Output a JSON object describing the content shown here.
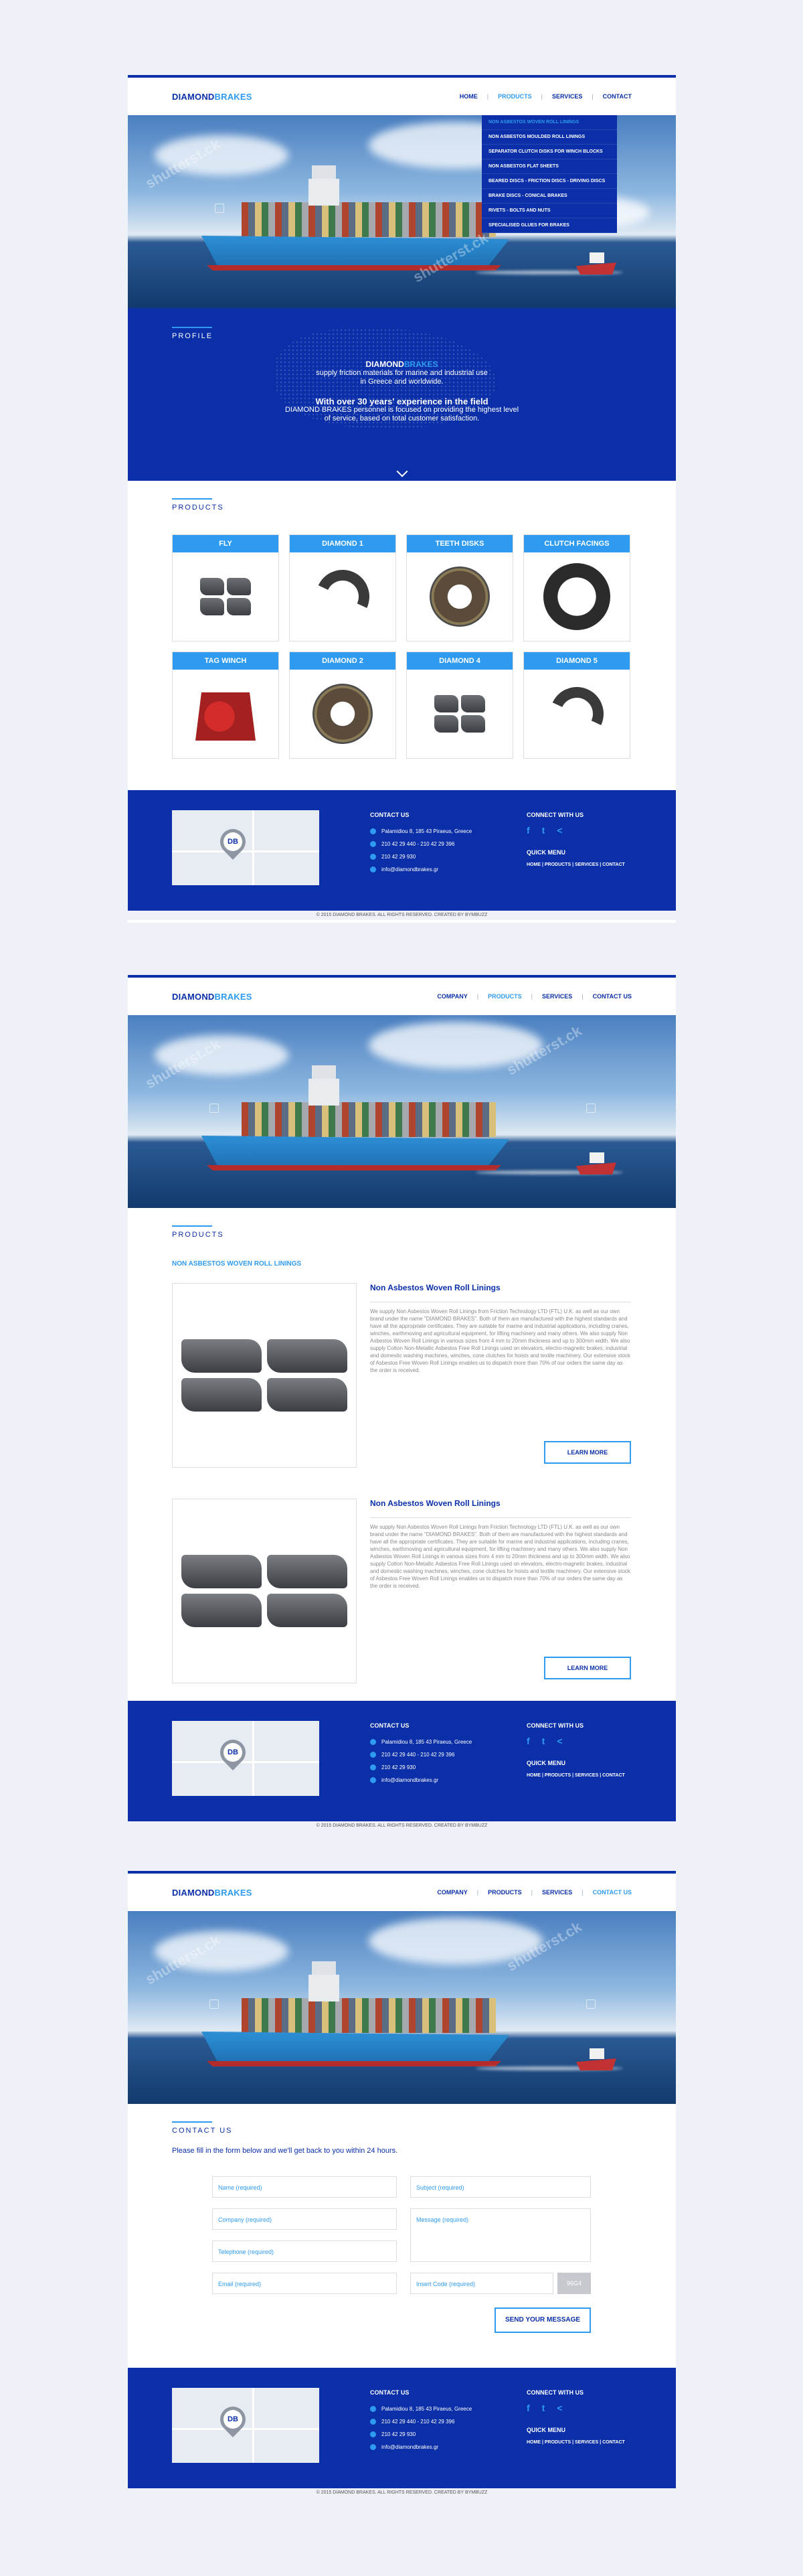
{
  "brand": {
    "part1": "DIAMOND",
    "part2": "BRAKES"
  },
  "nav1": {
    "items": [
      "HOME",
      "PRODUCTS",
      "SERVICES",
      "CONTACT"
    ]
  },
  "nav": {
    "items": [
      "COMPANY",
      "PRODUCTS",
      "SERVICES",
      "CONTACT US"
    ]
  },
  "dropdown": {
    "items": [
      "NON ASBESTOS WOVEN ROLL LININGS",
      "NON ASBESTOS MOULDED ROLL LININGS",
      "SEPARATOR CLUTCH DISKS FOR WINCH BLOCKS",
      "NON ASBESTOS FLAT SHEETS",
      "BEARED DISCS - FRICTION DISCS - DRIVING DISCS",
      "BRAKE DISCS - CONICAL BRAKES",
      "RIVETS - BOLTS AND NUTS",
      "SPECIALISED GLUES FOR BRAKES"
    ]
  },
  "watermark": "shutterst.ck",
  "profile": {
    "title": "PROFILE",
    "brand1": "DIAMOND",
    "brand2": "BRAKES",
    "line1": "supply friction materials for marine and industrial use",
    "line2": "in Greece and worldwide.",
    "lead": "With over 30 years' experience in the field",
    "line3": "DIAMOND BRAKES personnel is focused on providing the highest level",
    "line4": "of service, based on total customer satisfaction."
  },
  "products": {
    "title": "PRODUCTS",
    "cards": [
      "FLY",
      "DIAMOND 1",
      "TEETH DISKS",
      "CLUTCH FACINGS",
      "TAG WINCH",
      "DIAMOND 2",
      "DIAMOND 4",
      "DIAMOND 5"
    ]
  },
  "footer": {
    "contact_title": "CONTACT US",
    "address": "Palamidiou 8, 185 43 Piraeus, Greece",
    "phone": "210 42 29 440 - 210 42 29 396",
    "fax": "210 42 29 930",
    "email": "info@diamondbrakes.gr",
    "connect_title": "CONNECT WITH US",
    "menu_title": "QUICK MENU",
    "menu": "HOME | PRODUCTS | SERVICES | CONTACT",
    "map_logo": "DB",
    "copyright": "© 2015 DIAMOND BRAKES. ALL RIGHTS RESERVED. CREATED BY BYMBUZZ",
    "social": [
      "f",
      "t",
      "<"
    ]
  },
  "product_page": {
    "title": "PRODUCTS",
    "category": "NON ASBESTOS WOVEN ROLL LININGS",
    "items": [
      {
        "title": "Non Asbestos Woven Roll Linings",
        "cta": "LEARN MORE"
      },
      {
        "title": "Non Asbestos Woven Roll Linings",
        "cta": "LEARN MORE"
      }
    ],
    "paragraph": "We supply Non Asbestos Woven Roll Linings from Friction Technology LTD (FTL) U.K. as well as our own brand under the name \"DIAMOND BRAKES\". Both of them are manufactured with the highest standards and have all the appropriate certificates. They are suitable for marine and industrial applications, including cranes, winches, earthmoving and agricultural equipment, for lifting machinery and many others. We also supply Non Asbestos Woven Roll Linings in various sizes from 4 mm to 20mm thickness and up to 300mm width. We also supply Cotton Non-Metallic Asbestos Free Roll Linings used on elevators, electro-magnetic brakes, industrial and domestic washing machines, winches, cone clutches for hoists and textile machinery. Our extensive stock of Asbestos Free Woven Roll Linings enables us to dispatch more than 70% of our orders the same day as the order is received."
  },
  "contact_page": {
    "title": "CONTACT US",
    "intro": "Please fill in the form below and we'll get back to you within 24 hours.",
    "name": "Name (required)",
    "subject": "Subject (required)",
    "company": "Company (required)",
    "message": "Message (required)",
    "telephone": "Telephone (required)",
    "email": "Email (required)",
    "code": "Insert Code (required)",
    "captcha": "96G4",
    "send": "SEND YOUR MESSAGE"
  }
}
